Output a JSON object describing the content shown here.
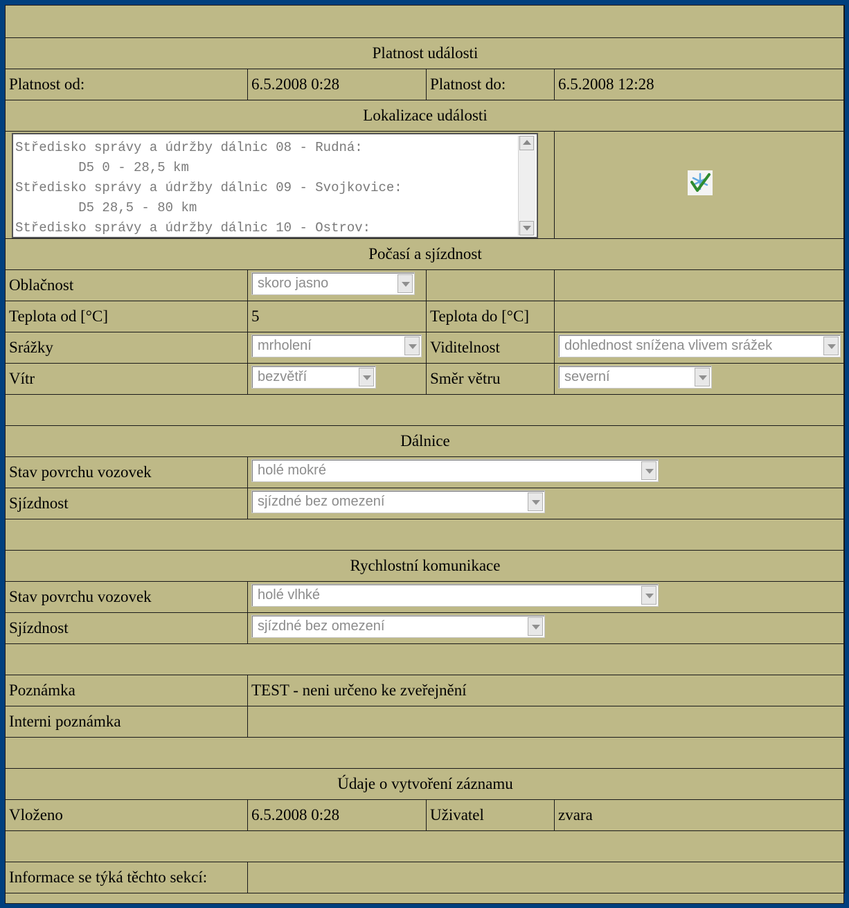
{
  "validity": {
    "section_title": "Platnost události",
    "from_label": "Platnost od:",
    "from_value": "6.5.2008 0:28",
    "to_label": "Platnost do:",
    "to_value": "6.5.2008 12:28"
  },
  "location": {
    "section_title": "Lokalizace události",
    "lines": [
      "Středisko správy a údržby dálnic 08 - Rudná:",
      "        D5 0 - 28,5 km",
      "Středisko správy a údržby dálnic 09 - Svojkovice:",
      "        D5 28,5 - 80 km",
      "Středisko správy a údržby dálnic 10 - Ostrov:"
    ],
    "icon": "checkmark-snowflake-icon"
  },
  "weather": {
    "section_title": "Počasí a sjízdnost",
    "cloudiness_label": "Oblačnost",
    "cloudiness_value": "skoro jasno",
    "temp_from_label": "Teplota od [°C]",
    "temp_from_value": "5",
    "temp_to_label": "Teplota do [°C]",
    "precip_label": "Srážky",
    "precip_value": "mrholení",
    "visibility_label": "Viditelnost",
    "visibility_value": "dohlednost snížena vlivem srážek",
    "wind_label": "Vítr",
    "wind_value": "bezvětří",
    "wind_dir_label": "Směr větru",
    "wind_dir_value": "severní"
  },
  "highway": {
    "section_title": "Dálnice",
    "surface_label": "Stav povrchu vozovek",
    "surface_value": "holé mokré",
    "passability_label": "Sjízdnost",
    "passability_value": "sjízdné bez omezení"
  },
  "expressway": {
    "section_title": "Rychlostní komunikace",
    "surface_label": "Stav povrchu vozovek",
    "surface_value": "holé vlhké",
    "passability_label": "Sjízdnost",
    "passability_value": "sjízdné bez omezení"
  },
  "notes": {
    "note_label": "Poznámka",
    "note_value": "TEST - neni určeno ke zveřejnění",
    "internal_label": "Interni poznámka"
  },
  "record": {
    "section_title": "Údaje o vytvoření záznamu",
    "inserted_label": "Vloženo",
    "inserted_value": "6.5.2008 0:28",
    "user_label": "Uživatel",
    "user_value": "zvara"
  },
  "sections_label": "Informace se týká těchto sekcí:",
  "colors": {
    "background": "#003F7E",
    "panel": "#BEB987",
    "border": "#1A1A1A"
  }
}
